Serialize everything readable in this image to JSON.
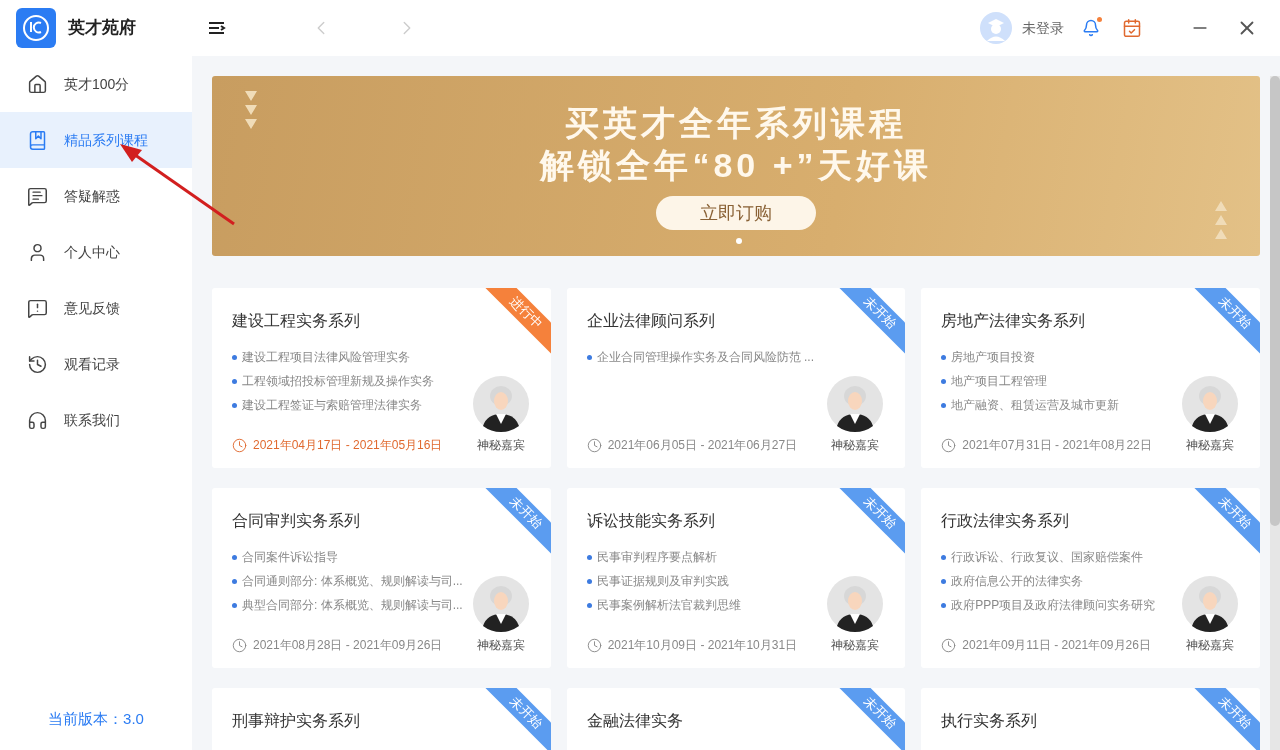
{
  "app": {
    "name": "英才苑府"
  },
  "user": {
    "label": "未登录",
    "has_notification": true
  },
  "sidebar": {
    "items": [
      {
        "label": "英才100分",
        "selected": false
      },
      {
        "label": "精品系列课程",
        "selected": true
      },
      {
        "label": "答疑解惑",
        "selected": false
      },
      {
        "label": "个人中心",
        "selected": false
      },
      {
        "label": "意见反馈",
        "selected": false
      },
      {
        "label": "观看记录",
        "selected": false
      },
      {
        "label": "联系我们",
        "selected": false
      }
    ],
    "version": "当前版本：3.0"
  },
  "banner": {
    "line_1": "买英才全年系列课程",
    "line_2": "解锁全年“80 +”天好课",
    "button": "立即订购"
  },
  "courses": [
    {
      "title": "建设工程实务系列",
      "status": {
        "kind": "ongoing",
        "label": "进行中"
      },
      "points": [
        "建设工程项目法律风险管理实务",
        "工程领域招投标管理新规及操作实务",
        "建设工程签证与索赔管理法律实务"
      ],
      "dates": "2021年04月17日 - 2021年05月16日",
      "speaker": "神秘嘉宾"
    },
    {
      "title": "企业法律顾问系列",
      "status": {
        "kind": "not_started",
        "label": "未开始"
      },
      "points": [
        "企业合同管理操作实务及合同风险防范 ..."
      ],
      "dates": "2021年06月05日 - 2021年06月27日",
      "speaker": "神秘嘉宾"
    },
    {
      "title": "房地产法律实务系列",
      "status": {
        "kind": "not_started",
        "label": "未开始"
      },
      "points": [
        "房地产项目投资",
        "地产项目工程管理",
        "地产融资、租赁运营及城市更新"
      ],
      "dates": "2021年07月31日 - 2021年08月22日",
      "speaker": "神秘嘉宾"
    },
    {
      "title": "合同审判实务系列",
      "status": {
        "kind": "not_started",
        "label": "未开始"
      },
      "points": [
        "合同案件诉讼指导",
        "合同通则部分: 体系概览、规则解读与司...",
        "典型合同部分: 体系概览、规则解读与司..."
      ],
      "dates": "2021年08月28日 - 2021年09月26日",
      "speaker": "神秘嘉宾"
    },
    {
      "title": "诉讼技能实务系列",
      "status": {
        "kind": "not_started",
        "label": "未开始"
      },
      "points": [
        "民事审判程序要点解析",
        "民事证据规则及审判实践",
        "民事案例解析法官裁判思维"
      ],
      "dates": "2021年10月09日 - 2021年10月31日",
      "speaker": "神秘嘉宾"
    },
    {
      "title": "行政法律实务系列",
      "status": {
        "kind": "not_started",
        "label": "未开始"
      },
      "points": [
        "行政诉讼、行政复议、国家赔偿案件",
        "政府信息公开的法律实务",
        "政府PPP项目及政府法律顾问实务研究"
      ],
      "dates": "2021年09月11日 - 2021年09月26日",
      "speaker": "神秘嘉宾"
    },
    {
      "title": "刑事辩护实务系列",
      "status": {
        "kind": "not_started",
        "label": "未开始"
      }
    },
    {
      "title": "金融法律实务",
      "status": {
        "kind": "not_started",
        "label": "未开始"
      }
    },
    {
      "title": "执行实务系列",
      "status": {
        "kind": "not_started",
        "label": "未开始"
      }
    }
  ]
}
